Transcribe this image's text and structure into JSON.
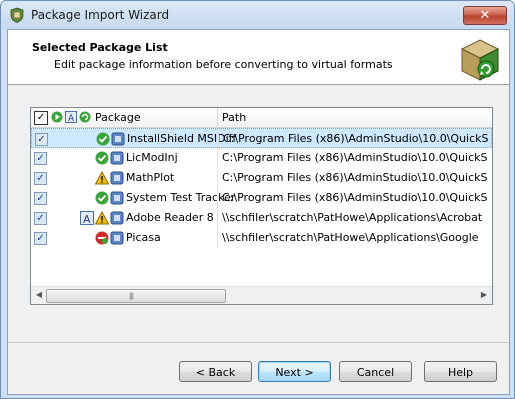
{
  "window": {
    "title": "Package Import Wizard",
    "close_glyph": "✕"
  },
  "header": {
    "title": "Selected Package List",
    "subtitle": "Edit package information before converting to virtual formats"
  },
  "grid": {
    "columns": {
      "package": "Package",
      "path": "Path"
    },
    "rows": [
      {
        "name": "InstallShield MSIDiff",
        "path": "C:\\Program Files (x86)\\AdminStudio\\10.0\\QuickS",
        "checked": true,
        "status": "ok",
        "selected": true
      },
      {
        "name": "LicModInj",
        "path": "C:\\Program Files (x86)\\AdminStudio\\10.0\\QuickS",
        "checked": true,
        "status": "ok"
      },
      {
        "name": "MathPlot",
        "path": "C:\\Program Files (x86)\\AdminStudio\\10.0\\QuickS",
        "checked": true,
        "status": "warning"
      },
      {
        "name": "System Test Tracker",
        "path": "C:\\Program Files (x86)\\AdminStudio\\10.0\\QuickS",
        "checked": true,
        "status": "ok"
      },
      {
        "name": "Adobe Reader 8",
        "path": "\\\\schfiler\\scratch\\PatHowe\\Applications\\Acrobat",
        "checked": true,
        "status": "warning-info"
      },
      {
        "name": "Picasa",
        "path": "\\\\schfiler\\scratch\\PatHowe\\Applications\\Google",
        "checked": true,
        "status": "error"
      }
    ],
    "check_glyph": "✓",
    "scroll_left": "◀",
    "scroll_right": "▶",
    "thumb_grip": "|||"
  },
  "buttons": {
    "back": "< Back",
    "next": "Next >",
    "cancel": "Cancel",
    "help": "Help"
  },
  "colors": {
    "selected_row": "#cde8ff",
    "ok_green": "#3aa53a",
    "warning_yellow": "#f2c200",
    "error_red": "#d32a2a"
  },
  "icons": {
    "title": "package-shield-icon",
    "logo": "package-box-icon",
    "ok": "green-check-icon",
    "warning": "warning-triangle-icon",
    "error": "red-error-icon",
    "package": "package-file-icon"
  }
}
